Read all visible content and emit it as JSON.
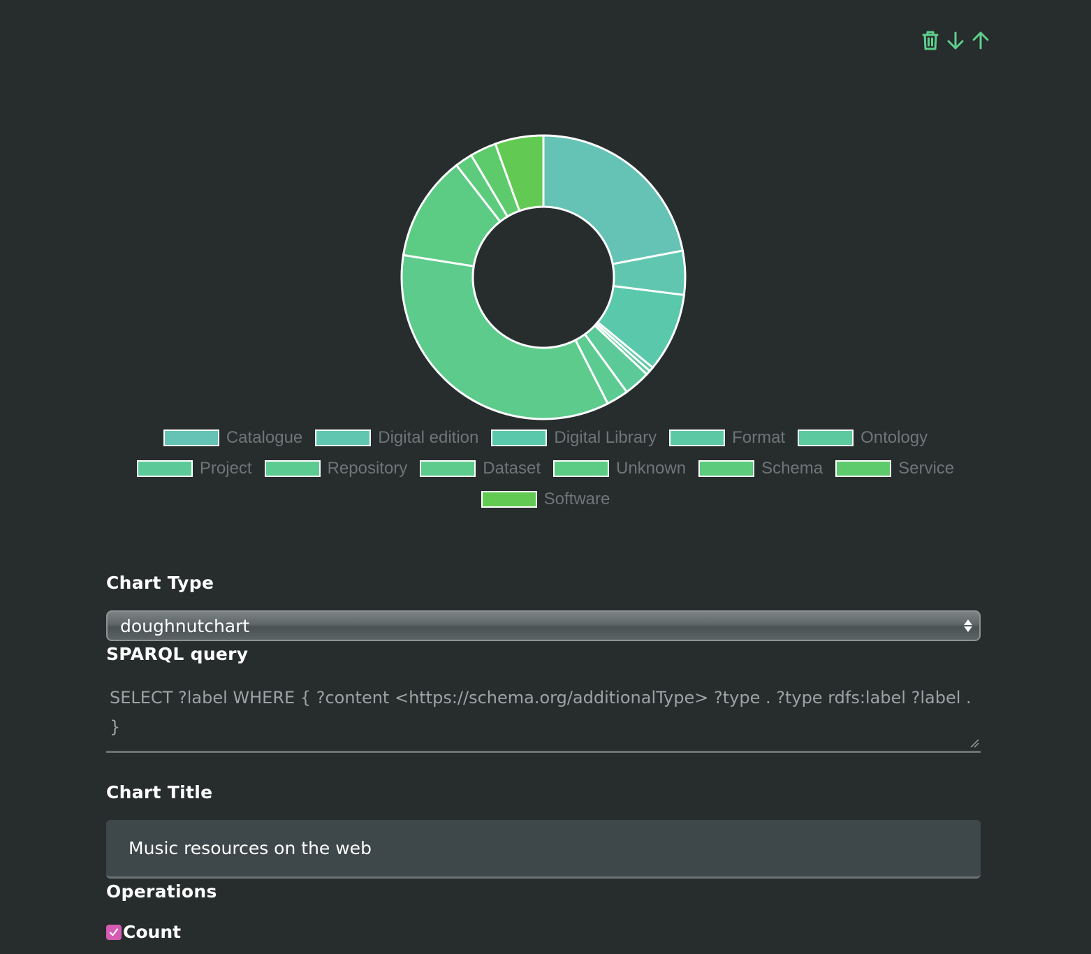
{
  "toolbar": {
    "icons": [
      "trash-icon",
      "arrow-down-icon",
      "arrow-up-icon"
    ],
    "icon_color": "#5fd08c"
  },
  "chart_data": {
    "type": "pie",
    "variant": "doughnut",
    "title": "",
    "categories": [
      "Catalogue",
      "Digital edition",
      "Digital Library",
      "Format",
      "Ontology",
      "Project",
      "Repository",
      "Dataset",
      "Unknown",
      "Schema",
      "Service",
      "Software"
    ],
    "values": [
      22,
      5,
      9,
      0.5,
      0.5,
      3,
      2.5,
      35,
      12,
      2,
      3,
      5.5
    ],
    "colors": [
      "#65c3b5",
      "#61c6b0",
      "#5ac8aa",
      "#5cc9a4",
      "#5cc99e",
      "#5cca98",
      "#5ccb92",
      "#5ccb8c",
      "#5ccb84",
      "#5ccc7c",
      "#5dcb6c",
      "#62ca52"
    ],
    "legend_position": "bottom"
  },
  "form": {
    "chart_type_label": "Chart Type",
    "chart_type_value": "doughnutchart",
    "sparql_label": "SPARQL query",
    "sparql_value": "SELECT ?label WHERE { ?content <https://schema.org/additionalType> ?type . ?type rdfs:label ?label . }",
    "chart_title_label": "Chart Title",
    "chart_title_value": "Music resources on the web",
    "operations_label": "Operations",
    "count_label": "Count",
    "count_checked": true
  }
}
